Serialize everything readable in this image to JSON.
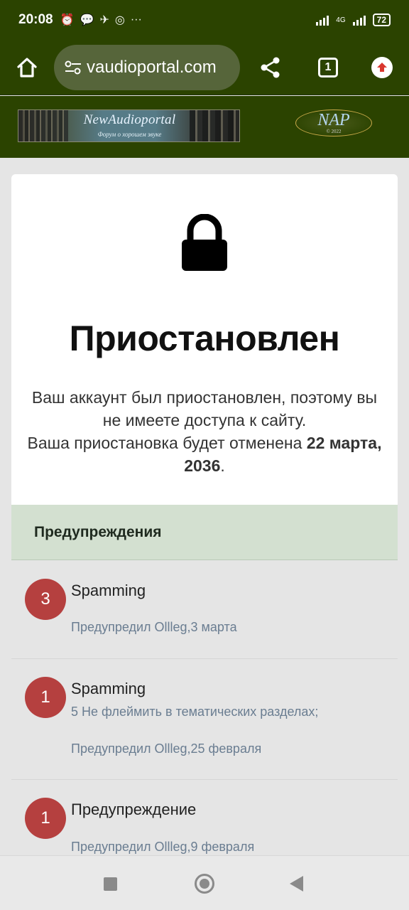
{
  "status_bar": {
    "time": "20:08",
    "icons": [
      "alarm-icon",
      "chat-icon",
      "telegram-icon",
      "vpn-icon",
      "more-icon"
    ],
    "network": "4G",
    "battery": "72"
  },
  "browser": {
    "url": "vaudioportal.com",
    "tab_count": "1"
  },
  "site": {
    "banner_title": "NewAudioportal",
    "banner_subtitle": "Форум о хорошем звуке",
    "logo_text": "NAP",
    "logo_year": "© 2022"
  },
  "suspended": {
    "title": "Приостановлен",
    "message_line1": "Ваш аккаунт был приостановлен, поэтому вы не имеете доступа к сайту.",
    "message_line2": "Ваша приостановка будет отменена",
    "date": "22 марта, 2036",
    "period": "."
  },
  "warnings": {
    "heading": "Предупреждения",
    "items": [
      {
        "points": "3",
        "title": "Spamming",
        "description": "",
        "meta": "Предупредил Ollleg,3 марта"
      },
      {
        "points": "1",
        "title": "Spamming",
        "description": "5 Не флеймить в тематических разделах;",
        "meta": "Предупредил Ollleg,25 февраля"
      },
      {
        "points": "1",
        "title": "Предупреждение",
        "description": "",
        "meta": "Предупредил Ollleg,9 февраля"
      }
    ]
  },
  "colors": {
    "header_bg": "#2b4300",
    "warning_header_bg": "#d3e0d0",
    "badge_bg": "#b5403f"
  }
}
